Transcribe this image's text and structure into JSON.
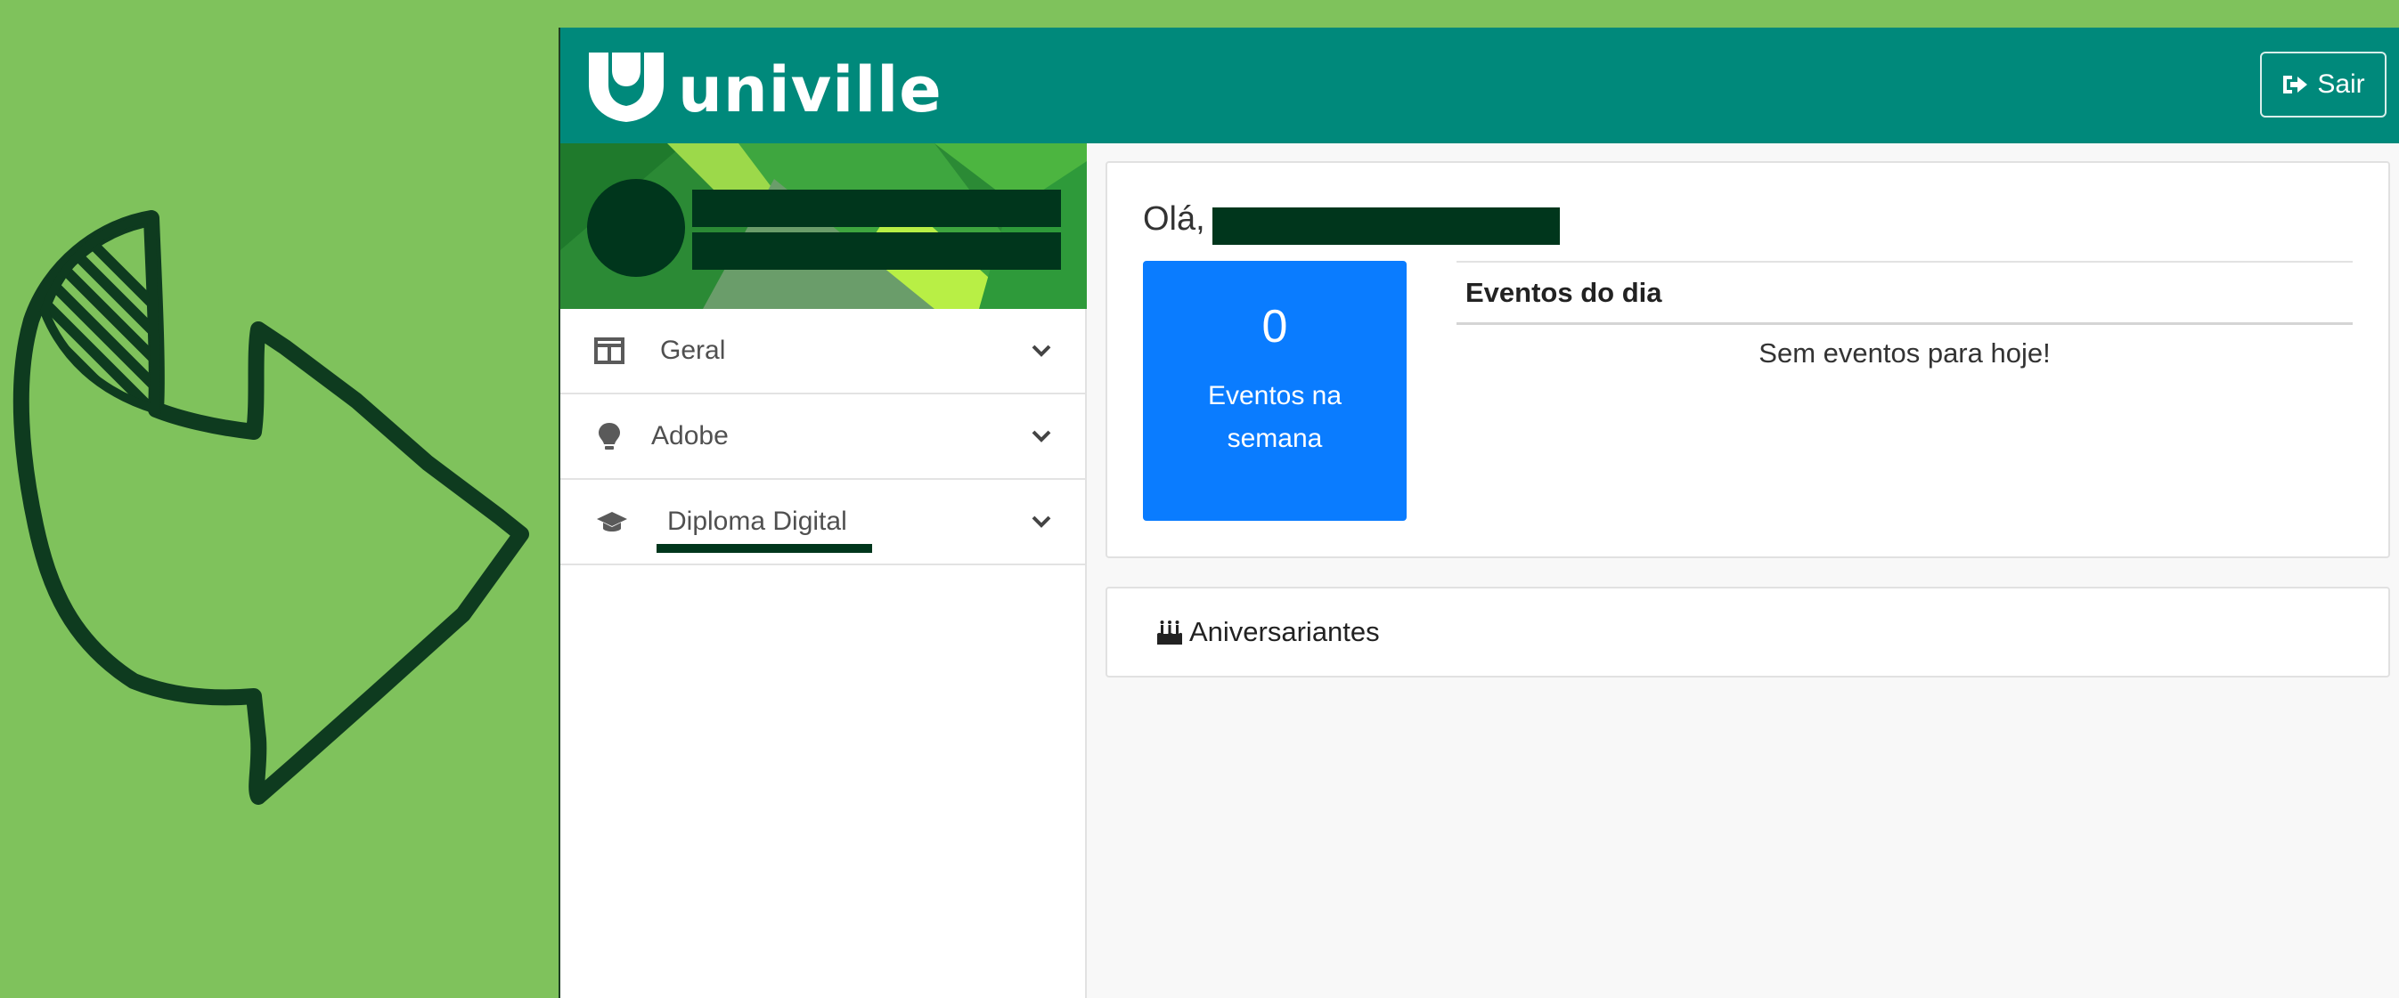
{
  "topbar": {
    "logo_text": "univille",
    "logout_label": "Sair"
  },
  "sidebar": {
    "items": [
      {
        "label": "Geral",
        "icon": "columns-icon"
      },
      {
        "label": "Adobe",
        "icon": "lightbulb-icon"
      },
      {
        "label": "Diploma Digital",
        "icon": "graduation-cap-icon"
      }
    ]
  },
  "welcome": {
    "greeting": "Olá,",
    "events_week_count": "0",
    "events_week_label_line1": "Eventos na",
    "events_week_label_line2": "semana",
    "events_today_title": "Eventos do dia",
    "events_today_empty": "Sem eventos para hoje!"
  },
  "birthdays": {
    "title": "Aniversariantes",
    "icon": "birthday-cake-icon"
  },
  "colors": {
    "background": "#7fc25c",
    "topbar": "#00897b",
    "stat_box": "#0a7cff",
    "redaction": "#00361c"
  }
}
